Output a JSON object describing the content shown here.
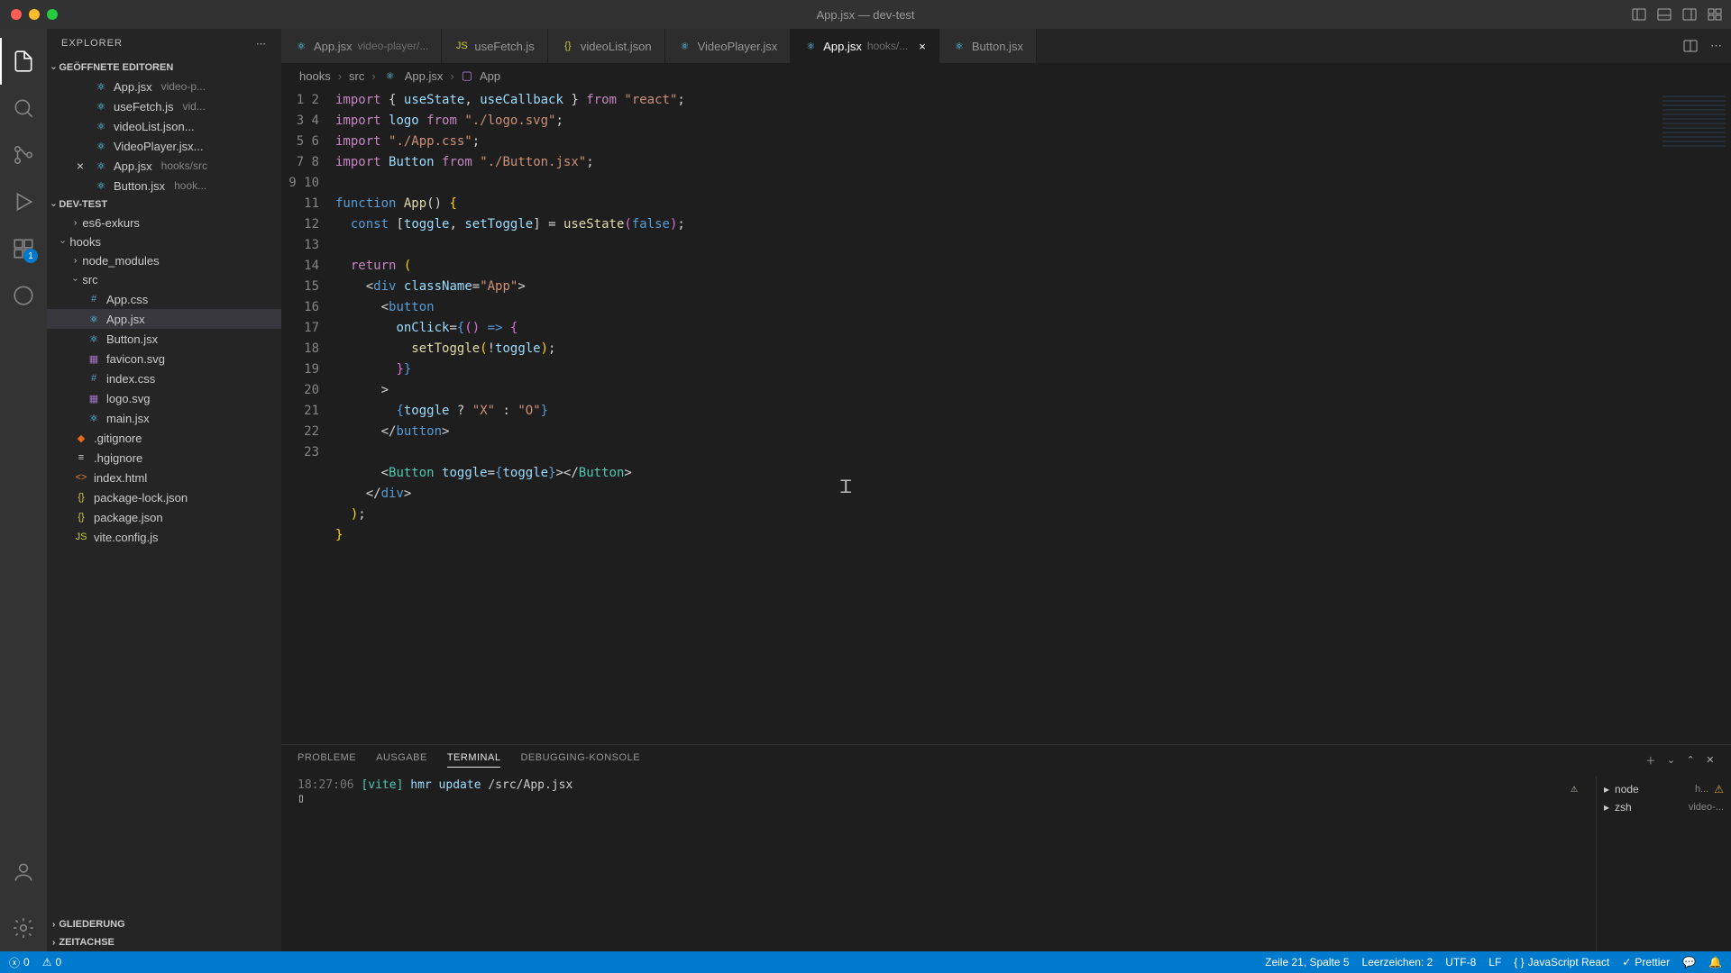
{
  "window": {
    "title": "App.jsx — dev-test"
  },
  "activity": {
    "ext_badge": "1"
  },
  "sidebar": {
    "title": "EXPLORER",
    "sections": {
      "open_editors": "GEÖFFNETE EDITOREN",
      "project": "DEV-TEST",
      "outline": "GLIEDERUNG",
      "timeline": "ZEITACHSE"
    },
    "open_editors": [
      {
        "name": "App.jsx",
        "meta": "video-p..."
      },
      {
        "name": "useFetch.js",
        "meta": "vid..."
      },
      {
        "name": "videoList.json...",
        "meta": ""
      },
      {
        "name": "VideoPlayer.jsx...",
        "meta": ""
      },
      {
        "name": "App.jsx",
        "meta": "hooks/src",
        "close": true
      },
      {
        "name": "Button.jsx",
        "meta": "hook..."
      }
    ],
    "tree": [
      {
        "label": "es6-exkurs",
        "kind": "folder",
        "level": 2
      },
      {
        "label": "hooks",
        "kind": "folder",
        "level": 1,
        "open": true
      },
      {
        "label": "node_modules",
        "kind": "folder",
        "level": 2
      },
      {
        "label": "src",
        "kind": "folder",
        "level": 2,
        "open": true
      },
      {
        "label": "App.css",
        "kind": "css",
        "level": 3
      },
      {
        "label": "App.jsx",
        "kind": "react",
        "level": 3,
        "selected": true
      },
      {
        "label": "Button.jsx",
        "kind": "react",
        "level": 3
      },
      {
        "label": "favicon.svg",
        "kind": "svg",
        "level": 3
      },
      {
        "label": "index.css",
        "kind": "css",
        "level": 3
      },
      {
        "label": "logo.svg",
        "kind": "svg",
        "level": 3
      },
      {
        "label": "main.jsx",
        "kind": "react",
        "level": 3
      },
      {
        "label": ".gitignore",
        "kind": "git",
        "level": 2
      },
      {
        "label": ".hgignore",
        "kind": "txt",
        "level": 2
      },
      {
        "label": "index.html",
        "kind": "html",
        "level": 2
      },
      {
        "label": "package-lock.json",
        "kind": "json",
        "level": 2
      },
      {
        "label": "package.json",
        "kind": "json",
        "level": 2
      },
      {
        "label": "vite.config.js",
        "kind": "js",
        "level": 2
      }
    ]
  },
  "tabs": [
    {
      "label": "App.jsx",
      "meta": "video-player/..."
    },
    {
      "label": "useFetch.js",
      "meta": ""
    },
    {
      "label": "videoList.json",
      "meta": ""
    },
    {
      "label": "VideoPlayer.jsx",
      "meta": ""
    },
    {
      "label": "App.jsx",
      "meta": "hooks/...",
      "active": true,
      "close": true
    },
    {
      "label": "Button.jsx",
      "meta": ""
    }
  ],
  "breadcrumb": [
    "hooks",
    "src",
    "App.jsx",
    "App"
  ],
  "code": {
    "line_count": 23,
    "lines_html": [
      "<span class='tok-kw'>import</span> <span class='tok-punc'>{</span> <span class='tok-var'>useState</span><span class='tok-punc'>,</span> <span class='tok-var'>useCallback</span> <span class='tok-punc'>}</span> <span class='tok-kw'>from</span> <span class='tok-str'>\"react\"</span><span class='tok-punc'>;</span>",
      "<span class='tok-kw'>import</span> <span class='tok-var'>logo</span> <span class='tok-kw'>from</span> <span class='tok-str'>\"./logo.svg\"</span><span class='tok-punc'>;</span>",
      "<span class='tok-kw'>import</span> <span class='tok-str'>\"./App.css\"</span><span class='tok-punc'>;</span>",
      "<span class='tok-kw'>import</span> <span class='tok-var'>Button</span> <span class='tok-kw'>from</span> <span class='tok-str'>\"./Button.jsx\"</span><span class='tok-punc'>;</span>",
      "",
      "<span class='tok-const'>function</span> <span class='tok-fn'>App</span><span class='tok-punc'>()</span> <span class='tok-brace'>{</span>",
      "  <span class='tok-const'>const</span> <span class='tok-punc'>[</span><span class='tok-var'>toggle</span><span class='tok-punc'>,</span> <span class='tok-var'>setToggle</span><span class='tok-punc'>]</span> <span class='tok-punc'>=</span> <span class='tok-fn'>useState</span><span class='tok-paren2'>(</span><span class='tok-const'>false</span><span class='tok-paren2'>)</span><span class='tok-punc'>;</span>",
      "",
      "  <span class='tok-kw'>return</span> <span class='tok-brace'>(</span>",
      "    <span class='tok-punc'>&lt;</span><span class='tok-tag'>div</span> <span class='tok-attr'>className</span><span class='tok-punc'>=</span><span class='tok-str'>\"App\"</span><span class='tok-punc'>&gt;</span>",
      "      <span class='tok-punc'>&lt;</span><span class='tok-tag'>button</span>",
      "        <span class='tok-attr'>onClick</span><span class='tok-punc'>=</span><span class='tok-const'>{</span><span class='tok-paren2'>()</span> <span class='tok-const'>=&gt;</span> <span class='tok-paren2'>{</span>",
      "          <span class='tok-fn'>setToggle</span><span class='tok-brace'>(</span><span class='tok-punc'>!</span><span class='tok-var'>toggle</span><span class='tok-brace'>)</span><span class='tok-punc'>;</span>",
      "        <span class='tok-paren2'>}</span><span class='tok-const'>}</span>",
      "      <span class='tok-punc'>&gt;</span>",
      "        <span class='tok-const'>{</span><span class='tok-var'>toggle</span> <span class='tok-punc'>?</span> <span class='tok-str'>\"X\"</span> <span class='tok-punc'>:</span> <span class='tok-str'>\"O\"</span><span class='tok-const'>}</span>",
      "      <span class='tok-punc'>&lt;/</span><span class='tok-tag'>button</span><span class='tok-punc'>&gt;</span>",
      "",
      "      <span class='tok-punc'>&lt;</span><span class='tok-comp'>Button</span> <span class='tok-attr'>toggle</span><span class='tok-punc'>=</span><span class='tok-const'>{</span><span class='tok-var'>toggle</span><span class='tok-const'>}</span><span class='tok-punc'>&gt;&lt;/</span><span class='tok-comp'>Button</span><span class='tok-punc'>&gt;</span>",
      "    <span class='tok-punc'>&lt;/</span><span class='tok-tag'>div</span><span class='tok-punc'>&gt;</span>",
      "  <span class='tok-brace'>)</span><span class='tok-punc'>;</span>",
      "<span class='tok-brace'>}</span>",
      ""
    ]
  },
  "panel": {
    "tabs": {
      "probleme": "PROBLEME",
      "ausgabe": "AUSGABE",
      "terminal": "TERMINAL",
      "debug": "DEBUGGING-KONSOLE"
    },
    "terminal": {
      "time": "18:27:06",
      "tag": "[vite]",
      "msg1": "hmr update",
      "path": "/src/App.jsx",
      "list": [
        {
          "name": "node",
          "meta": "h...",
          "warn": true
        },
        {
          "name": "zsh",
          "meta": "video-..."
        }
      ]
    }
  },
  "status": {
    "errors": "0",
    "warnings": "0",
    "position": "Zeile 21, Spalte 5",
    "indent": "Leerzeichen: 2",
    "encoding": "UTF-8",
    "eol": "LF",
    "lang": "JavaScript React",
    "formatter": "Prettier"
  }
}
